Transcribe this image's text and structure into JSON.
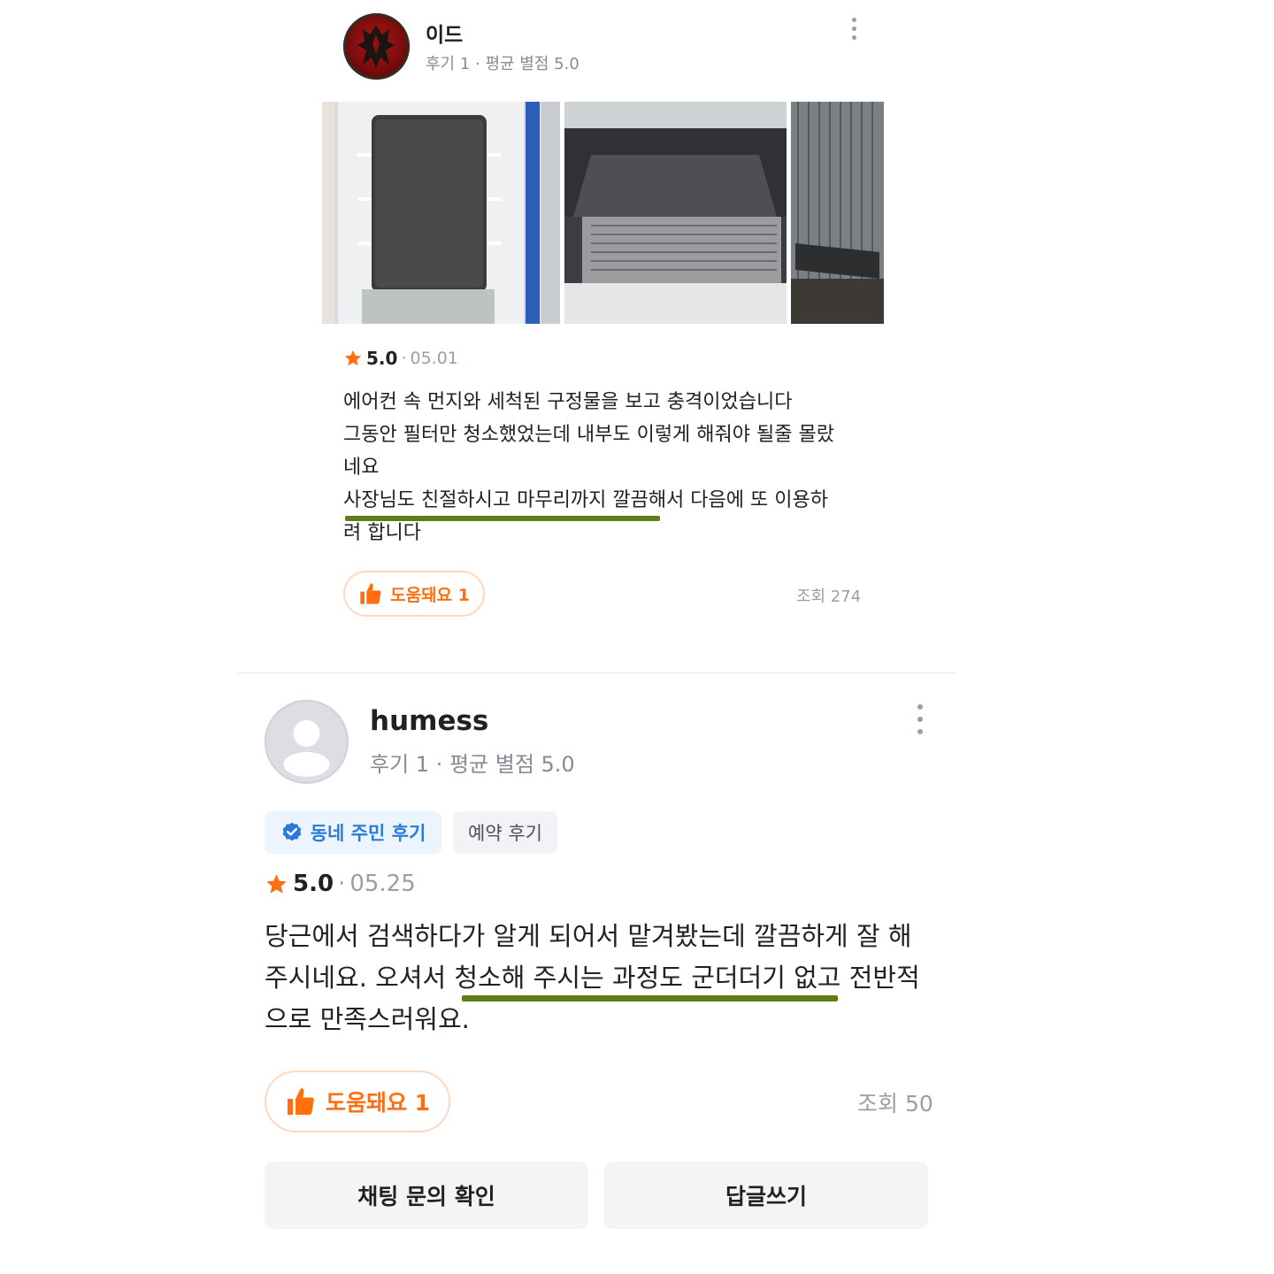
{
  "review1": {
    "author": "이드",
    "meta": "후기 1 · 평균 별점 5.0",
    "avatar_icon": "horde-emblem-avatar",
    "photos": [
      "aircon-filter-photo",
      "aircon-interior-photo",
      "aircon-coil-photo"
    ],
    "score": "5.0",
    "sep": "·",
    "date": "05.01",
    "lines": [
      "에어컨 속 먼지와 세척된 구정물을 보고 충격이었습니다",
      "그동안 필터만 청소했었는데 내부도 이렇게 해줘야 될줄 몰랐",
      "네요",
      "사장님도 친절하시고 마무리까지 깔끔해서 다음에 또 이용하",
      "려 합니다"
    ],
    "helpful_label": "도움돼요 1",
    "views": "조회 274"
  },
  "review2": {
    "author": "humess",
    "meta": "후기 1 · 평균 별점 5.0",
    "badges": {
      "neighbor": "동네 주민 후기",
      "booking": "예약 후기"
    },
    "score": "5.0",
    "sep": "·",
    "date": "05.25",
    "lines": [
      "당근에서 검색하다가 알게 되어서 맡겨봤는데 깔끔하게 잘 해",
      "주시네요. 오셔서 청소해 주시는 과정도 군더더기 없고 전반적",
      "으로 만족스러워요."
    ],
    "helpful_label": "도움돼요 1",
    "views": "조회 50"
  },
  "actions": {
    "chat": "채팅 문의 확인",
    "reply": "답글쓰기"
  },
  "colors": {
    "accent": "#ff6f0f",
    "verified": "#2a7bd8",
    "highlight_underline": "#5f7d1a"
  }
}
